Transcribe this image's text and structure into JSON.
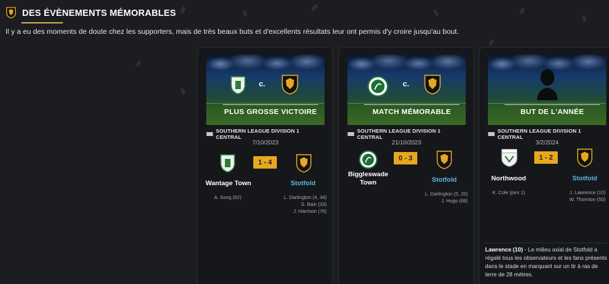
{
  "header": {
    "title": "DES ÉVÈNEMENTS MÉMORABLES",
    "intro": "Il y a eu des moments de doute chez les supporters, mais de très beaux buts et d'excellents résultats leur ont permis d'y croire jusqu'au bout."
  },
  "colors": {
    "accent": "#e7a81f",
    "favourite_team": "#5fb7e5",
    "background": "#1b1d21",
    "card": "#15171a"
  },
  "cards": [
    {
      "banner_label": "PLUS GROSSE VICTOIRE",
      "vs": "c.",
      "competition": "SOUTHERN LEAGUE DIVISION 1 CENTRAL",
      "date": "7/10/2023",
      "score": "1 - 4",
      "home": {
        "name": "Wantage Town",
        "crest_icon": "wantage-town-crest-icon",
        "scorers": [
          "A. Song (62)"
        ]
      },
      "away": {
        "name": "Stotfold",
        "crest_icon": "stotfold-crest-icon",
        "scorers": [
          "L. Darlington (4, 34)",
          "S. Bain (33)",
          "J. Harrison (76)"
        ]
      }
    },
    {
      "banner_label": "MATCH MÉMORABLE",
      "vs": "c.",
      "competition": "SOUTHERN LEAGUE DIVISION 1 CENTRAL",
      "date": "21/10/2023",
      "score": "0 - 3",
      "home": {
        "name_line1": "Biggleswade",
        "name_line2": "Town",
        "crest_icon": "biggleswade-town-crest-icon",
        "scorers": []
      },
      "away": {
        "name": "Stotfold",
        "crest_icon": "stotfold-crest-icon",
        "scorers": [
          "L. Darlington (5, 20)",
          "J. Hugo (68)"
        ]
      }
    },
    {
      "banner_label": "BUT DE L'ANNÉE",
      "competition": "SOUTHERN LEAGUE DIVISION 1 CENTRAL",
      "date": "3/2/2024",
      "score": "1 - 2",
      "home": {
        "name": "Northwood",
        "crest_icon": "northwood-crest-icon",
        "scorers": [
          "K. Cole (pen 1)"
        ]
      },
      "away": {
        "name": "Stotfold",
        "crest_icon": "stotfold-crest-icon",
        "scorers": [
          "J. Lawrence (10)",
          "W. Thornton (50)"
        ]
      },
      "description_player": "Lawrence (10)",
      "description_text": "- Le milieu axial de Stotfold a régalé tous les observateurs et les fans présents dans le stade en marquant sur un tir à ras de terre de 28 mètres."
    }
  ]
}
